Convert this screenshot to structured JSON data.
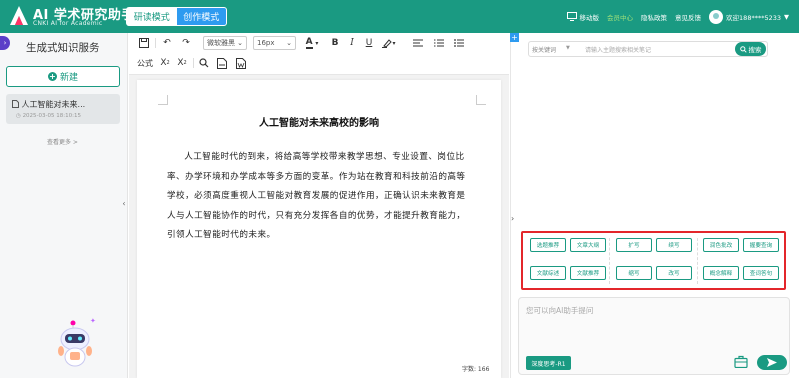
{
  "header": {
    "logo_title": "AI 学术研究助手",
    "logo_subtitle": "CNKI AI for Academic",
    "mode_read": "研读模式",
    "mode_create": "创作模式",
    "nav": {
      "mobile": "移动版",
      "member": "会员中心",
      "privacy": "隐私政策",
      "feedback": "意见反馈",
      "user": "欢迎188****5233"
    },
    "brand_color": "#1a9a82",
    "accent_color": "#2e9bf0"
  },
  "sidebar": {
    "title": "生成式知识服务",
    "new_label": "新建",
    "docs": [
      {
        "title": "人工智能对未来...",
        "date": "2025-03-05 18:10:15"
      }
    ],
    "see_more": "查看更多 >"
  },
  "toolbar": {
    "font_family": "微软雅黑",
    "font_size": "16px",
    "formula": "公式"
  },
  "document": {
    "title": "人工智能对未来高校的影响",
    "body": "人工智能时代的到来，将给高等学校带来教学思想、专业设置、岗位比率、办学环境和办学成本等多方面的变革。作为站在教育和科技前沿的高等学校，必须高度重视人工智能对教育发展的促进作用，正确认识未来教育是人与人工智能协作的时代，只有充分发挥各自的优势，才能提升教育能力，引领人工智能时代的未来。",
    "word_count": "字数: 166"
  },
  "assistant": {
    "search": {
      "select": "按关键词",
      "placeholder": "请输入主题搜索相关笔记",
      "button": "搜索"
    },
    "tools": {
      "row1": [
        "选题推荐",
        "文章大纲",
        "扩写",
        "续写",
        "润色批改",
        "握要查询"
      ],
      "row2": [
        "文献综述",
        "文献推荐",
        "缩写",
        "改写",
        "概念解释",
        "查词答句"
      ]
    },
    "input_placeholder": "您可以向AI助手提问",
    "deep_think": "深度思考-R1",
    "highlight_color": "#e3262b"
  }
}
